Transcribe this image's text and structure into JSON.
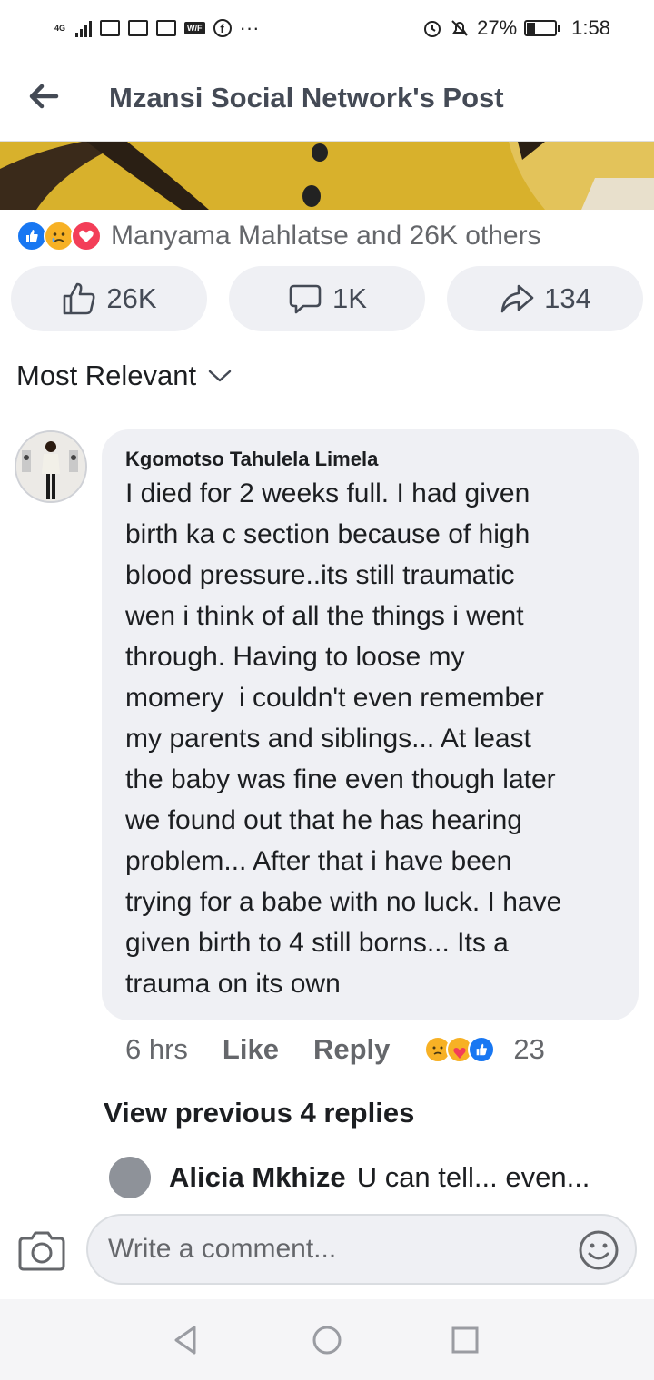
{
  "status_bar": {
    "network": "4G",
    "battery": "27%",
    "battery_level": 0.27,
    "time": "1:58"
  },
  "header": {
    "title": "Mzansi Social Network's Post",
    "back_icon": "arrow-left-icon"
  },
  "reactions": {
    "icons": [
      "like-icon",
      "sad-icon",
      "love-icon"
    ],
    "summary": "Manyama Mahlatse and 26K others"
  },
  "actions": {
    "like_count": "26K",
    "comment_count": "1K",
    "share_count": "134"
  },
  "sort": {
    "label": "Most Relevant"
  },
  "comment": {
    "author": "Kgomotso Tahulela Limela",
    "lines": [
      "I died for 2 weeks full. I had given",
      "birth ka c section because of high",
      "blood pressure..its still traumatic",
      "wen i think of all the things i went",
      "through. Having to loose my",
      "momery  i couldn't even remember",
      "my parents and siblings... At least",
      "the baby was fine even though later",
      "we found out that he has hearing",
      "problem... After that i have been",
      "trying for a babe with no luck. I have",
      "given birth to 4 still borns... Its a",
      "trauma on its own"
    ],
    "time": "6 hrs",
    "like_label": "Like",
    "reply_label": "Reply",
    "reaction_icons": [
      "sad-icon",
      "care-icon",
      "like-icon"
    ],
    "reaction_count": "23"
  },
  "replies": {
    "view_previous": "View previous 4 replies",
    "preview_author": "Alicia Mkhize",
    "preview_text": "U can tell... even..."
  },
  "composer": {
    "placeholder": "Write a comment..."
  },
  "colors": {
    "like_blue": "#1877f2",
    "love_red": "#f33e58",
    "sad_yellow": "#f7b125",
    "secondary_text": "#65676b",
    "bubble_bg": "#eff0f4"
  }
}
